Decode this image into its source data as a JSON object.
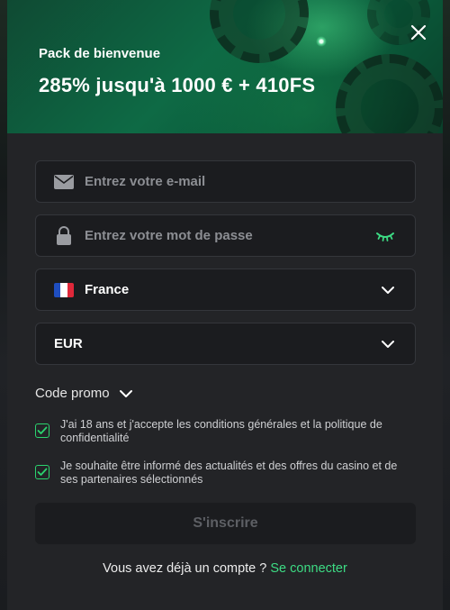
{
  "banner": {
    "subtitle": "Pack de bienvenue",
    "title": "285% jusqu'à 1000 € + 410FS"
  },
  "form": {
    "email_placeholder": "Entrez votre e-mail",
    "password_placeholder": "Entrez votre mot de passe",
    "country": "France",
    "currency": "EUR",
    "promo_label": "Code promo",
    "terms_label": "J'ai 18 ans et j'accepte les conditions générales et la politique de confidentialité",
    "terms_checked": true,
    "newsletter_label": "Je souhaite être informé des actualités et des offres du casino et de ses partenaires sélectionnés",
    "newsletter_checked": true,
    "submit_label": "S'inscrire"
  },
  "footer": {
    "question": "Vous avez déjà un compte ?",
    "login_link": "Se connecter"
  },
  "icons": {
    "close": "close-icon",
    "email": "envelope-icon",
    "password": "lock-icon",
    "reveal": "eye-icon",
    "country": "france-flag-icon",
    "dropdown": "chevron-down-icon",
    "checkbox": "checkmark-icon"
  },
  "colors": {
    "accent": "#3ddc84",
    "check": "#2bd36e",
    "banner": "#0e6a45",
    "modal_bg": "#232427",
    "field_bg": "#1b1c1f"
  }
}
